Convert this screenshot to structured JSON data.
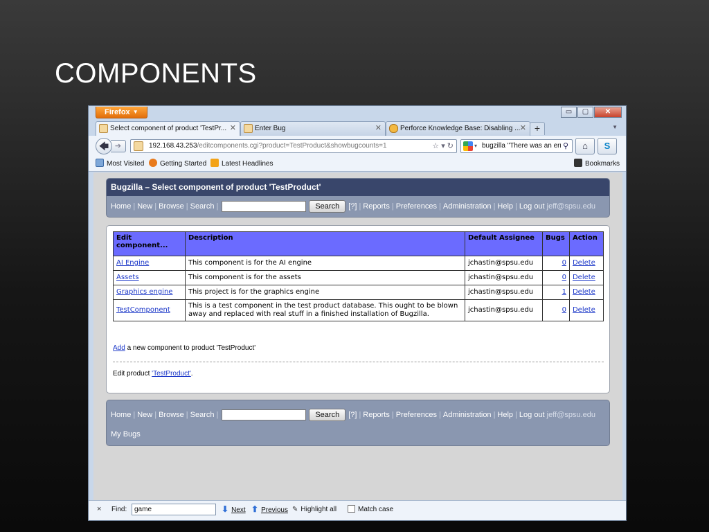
{
  "slide": {
    "title": "COMPONENTS"
  },
  "browser": {
    "menu_button": "Firefox",
    "window_controls": {
      "minimize": "▭",
      "maximize": "▢",
      "close": "✕"
    },
    "tabs": [
      {
        "label": "Select component of product 'TestPr...",
        "close": "✕"
      },
      {
        "label": "Enter Bug",
        "close": "✕"
      },
      {
        "label": "Perforce Knowledge Base: Disabling ...",
        "close": "✕"
      }
    ],
    "new_tab": "+",
    "url": {
      "host": "192.168.43.253",
      "path": "/editcomponents.cgi?product=TestProduct&showbugcounts=1"
    },
    "search_value": "bugzilla \"There was an err",
    "bookmarks": {
      "most_visited": "Most Visited",
      "getting_started": "Getting Started",
      "latest_headlines": "Latest Headlines",
      "bookmarks": "Bookmarks"
    }
  },
  "bugzilla": {
    "page_title": "Bugzilla – Select component of product 'TestProduct'",
    "nav": {
      "home": "Home",
      "new": "New",
      "browse": "Browse",
      "search": "Search",
      "search_button": "Search",
      "help_link": "[?]",
      "reports": "Reports",
      "preferences": "Preferences",
      "administration": "Administration",
      "help": "Help",
      "logout": "Log out",
      "user": "jeff@spsu.edu"
    },
    "table": {
      "headers": [
        "Edit component...",
        "Description",
        "Default Assignee",
        "Bugs",
        "Action"
      ],
      "rows": [
        {
          "name": "AI Engine",
          "description": "This component is for the AI engine",
          "assignee": "jchastin@spsu.edu",
          "bugs": "0",
          "action": "Delete"
        },
        {
          "name": "Assets",
          "description": "This component is for the assets",
          "assignee": "jchastin@spsu.edu",
          "bugs": "0",
          "action": "Delete"
        },
        {
          "name": "Graphics engine",
          "description": "This project is for the graphics engine",
          "assignee": "jchastin@spsu.edu",
          "bugs": "1",
          "action": "Delete"
        },
        {
          "name": "TestComponent",
          "description": "This is a test component in the test product database. This ought to be blown away and replaced with real stuff in a finished installation of Bugzilla.",
          "assignee": "jchastin@spsu.edu",
          "bugs": "0",
          "action": "Delete"
        }
      ]
    },
    "add_link": "Add",
    "add_text": " a new component to product 'TestProduct'",
    "edit_prefix": "Edit product ",
    "edit_link": "'TestProduct'",
    "edit_suffix": ".",
    "my_bugs": "My Bugs"
  },
  "findbar": {
    "close": "×",
    "label": "Find:",
    "value": "game",
    "next": "Next",
    "previous": "Previous",
    "highlight_all": "Highlight all",
    "match_case": "Match case"
  }
}
